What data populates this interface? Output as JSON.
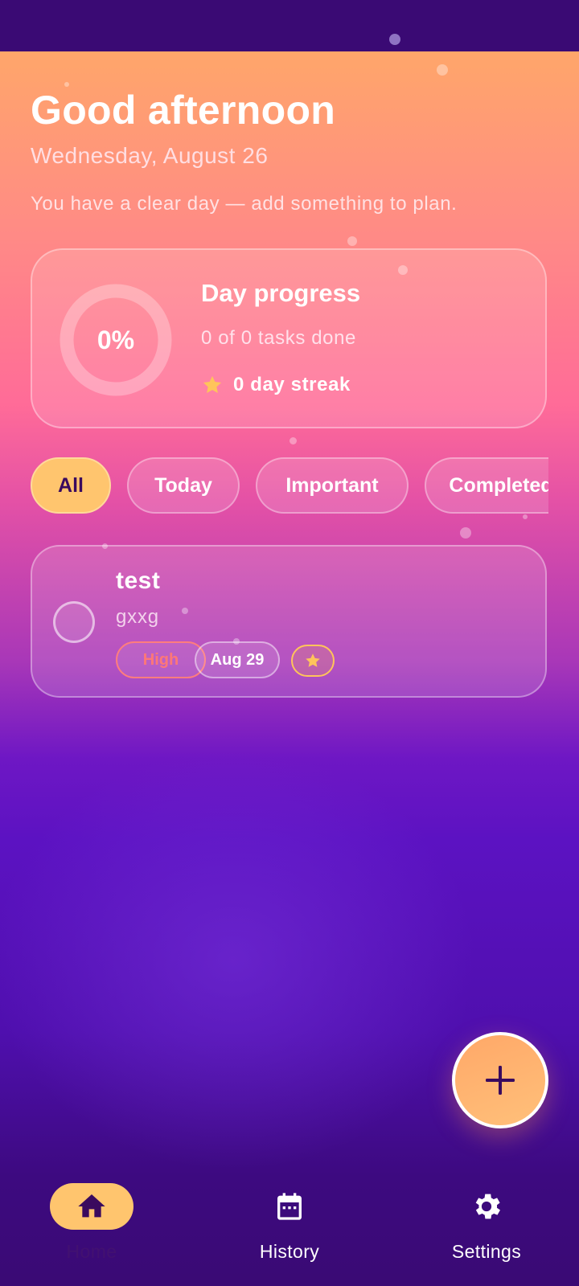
{
  "colors": {
    "accent": "#ffc56e",
    "background_top": "#ffa66a",
    "background_bottom": "#3a0a74",
    "priority_high": "#ff7777",
    "star": "#ffc45a"
  },
  "header": {
    "greeting": "Good afternoon",
    "date": "Wednesday, August 26",
    "summary": "You have a clear day — add something to plan."
  },
  "progress": {
    "percent_label": "0%",
    "percent_value": 0,
    "title": "Day progress",
    "tasks_done": "0 of 0 tasks done",
    "streak": "0 day streak",
    "streak_icon": "star-icon"
  },
  "filters": {
    "selected": "All",
    "items": [
      {
        "label": "All"
      },
      {
        "label": "Today"
      },
      {
        "label": "Important"
      },
      {
        "label": "Completed"
      }
    ]
  },
  "tasks": [
    {
      "title": "test",
      "description": "gxxg",
      "priority": "High",
      "due": "Aug 29",
      "important": true,
      "completed": false
    }
  ],
  "fab": {
    "icon": "plus-icon"
  },
  "nav": {
    "items": [
      {
        "label": "Home",
        "icon": "home-icon",
        "active": true
      },
      {
        "label": "History",
        "icon": "calendar-icon",
        "active": false
      },
      {
        "label": "Settings",
        "icon": "gear-icon",
        "active": false
      }
    ]
  }
}
